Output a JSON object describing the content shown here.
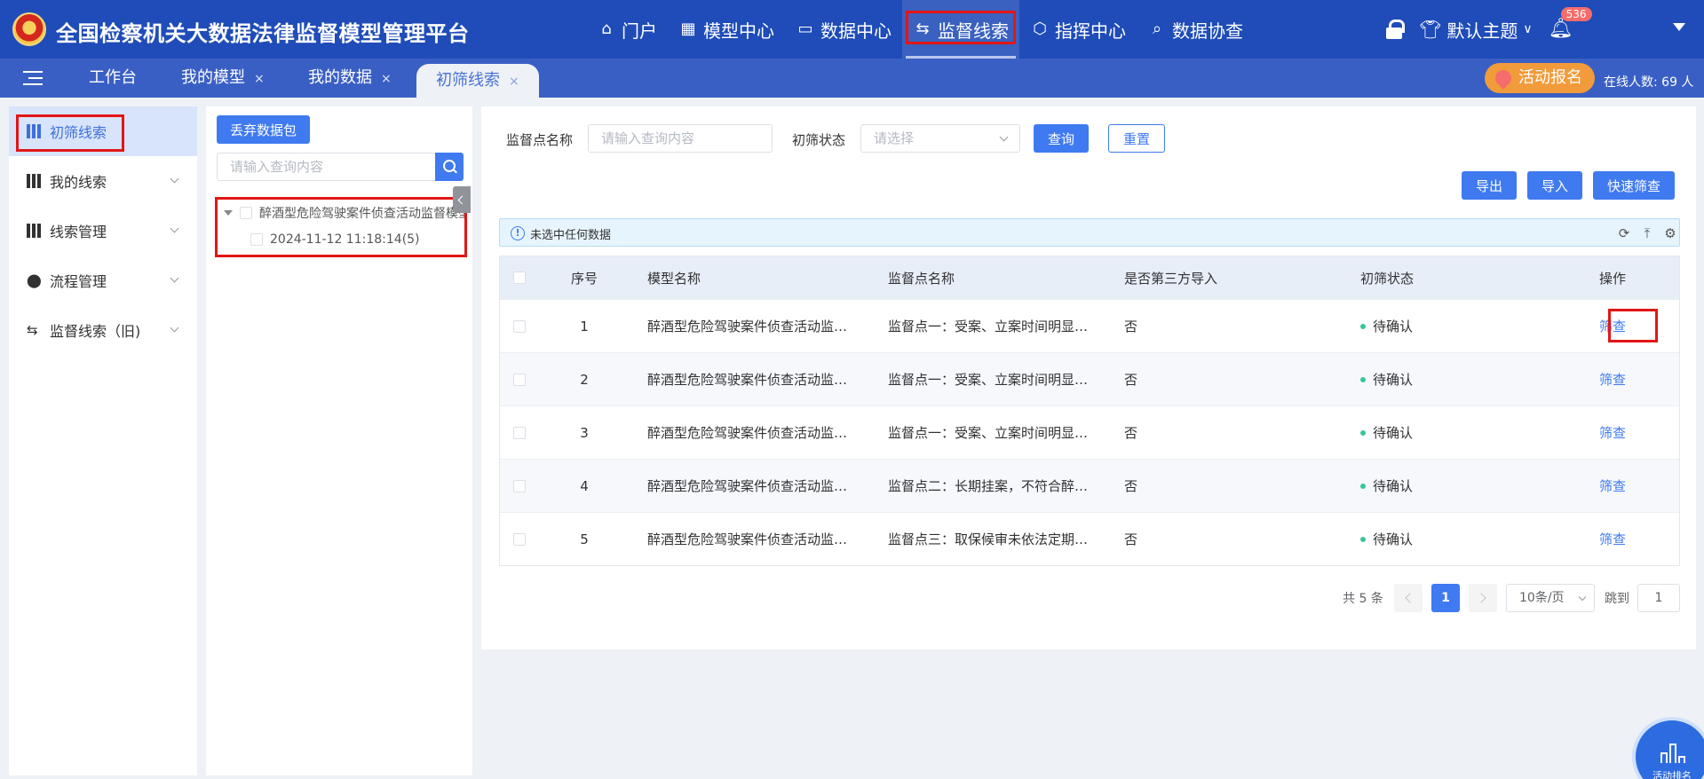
{
  "header": {
    "title": "全国检察机关大数据法律监督模型管理平台",
    "nav": [
      {
        "label": "门户",
        "icon": "home-icon",
        "glyph": "⌂"
      },
      {
        "label": "模型中心",
        "icon": "grid-icon",
        "glyph": "▦"
      },
      {
        "label": "数据中心",
        "icon": "monitor-icon",
        "glyph": "▭"
      },
      {
        "label": "监督线索",
        "icon": "route-icon",
        "glyph": "⇆",
        "active": true
      },
      {
        "label": "指挥中心",
        "icon": "cube-icon",
        "glyph": "⬡"
      },
      {
        "label": "数据协查",
        "icon": "search-doc-icon",
        "glyph": "⌕"
      }
    ],
    "theme_label": "默认主题",
    "notification_count": "536"
  },
  "tabs": {
    "items": [
      {
        "label": "工作台",
        "closable": false
      },
      {
        "label": "我的模型",
        "closable": true
      },
      {
        "label": "我的数据",
        "closable": true
      },
      {
        "label": "初筛线索",
        "closable": true,
        "active": true
      }
    ],
    "close_glyph": "×",
    "activity_label": "活动报名",
    "online_text": "在线人数: 69 人"
  },
  "sidebar": {
    "items": [
      {
        "label": "初筛线索",
        "icon": "barcode-icon",
        "active": true
      },
      {
        "label": "我的线索",
        "icon": "barcode-icon",
        "expandable": true
      },
      {
        "label": "线索管理",
        "icon": "barcode-icon",
        "expandable": true
      },
      {
        "label": "流程管理",
        "icon": "stamp-icon",
        "expandable": true
      },
      {
        "label": "监督线索（旧)",
        "icon": "route-icon",
        "expandable": true
      }
    ]
  },
  "tree_panel": {
    "discard_label": "丢弃数据包",
    "search_placeholder": "请输入查询内容",
    "nodes": [
      {
        "label": "醉酒型危险驾驶案件侦查活动监督模型",
        "level": 0
      },
      {
        "label": "2024-11-12 11:18:14(5)",
        "level": 1
      }
    ]
  },
  "filters": {
    "point_label": "监督点名称",
    "point_placeholder": "请输入查询内容",
    "status_label": "初筛状态",
    "status_placeholder": "请选择",
    "query_label": "查询",
    "reset_label": "重置",
    "export_label": "导出",
    "import_label": "导入",
    "quick_label": "快速筛查"
  },
  "notice": {
    "icon": "info-icon",
    "text": "未选中任何数据"
  },
  "table": {
    "headers": {
      "index": "序号",
      "model": "模型名称",
      "point": "监督点名称",
      "third_party": "是否第三方导入",
      "status": "初筛状态",
      "action": "操作"
    },
    "rows": [
      {
        "index": "1",
        "model": "醉酒型危险驾驶案件侦查活动监…",
        "point": "监督点一：受案、立案时间明显…",
        "third_party": "否",
        "status": "待确认",
        "action": "筛查"
      },
      {
        "index": "2",
        "model": "醉酒型危险驾驶案件侦查活动监…",
        "point": "监督点一：受案、立案时间明显…",
        "third_party": "否",
        "status": "待确认",
        "action": "筛查"
      },
      {
        "index": "3",
        "model": "醉酒型危险驾驶案件侦查活动监…",
        "point": "监督点一：受案、立案时间明显…",
        "third_party": "否",
        "status": "待确认",
        "action": "筛查"
      },
      {
        "index": "4",
        "model": "醉酒型危险驾驶案件侦查活动监…",
        "point": "监督点二：长期挂案，不符合醉…",
        "third_party": "否",
        "status": "待确认",
        "action": "筛查"
      },
      {
        "index": "5",
        "model": "醉酒型危险驾驶案件侦查活动监…",
        "point": "监督点三：取保候审未依法定期…",
        "third_party": "否",
        "status": "待确认",
        "action": "筛查"
      }
    ],
    "status_color": "#38c59b"
  },
  "pagination": {
    "total_text": "共 5 条",
    "current_page": "1",
    "page_size": "10条/页",
    "jump_label": "跳到",
    "jump_value": "1"
  },
  "float_button": {
    "label": "活动排名",
    "icon": "ranking-icon"
  },
  "colors": {
    "primary": "#3f7af0",
    "header_bg": "#1f4cb8",
    "highlight": "#e31515"
  }
}
